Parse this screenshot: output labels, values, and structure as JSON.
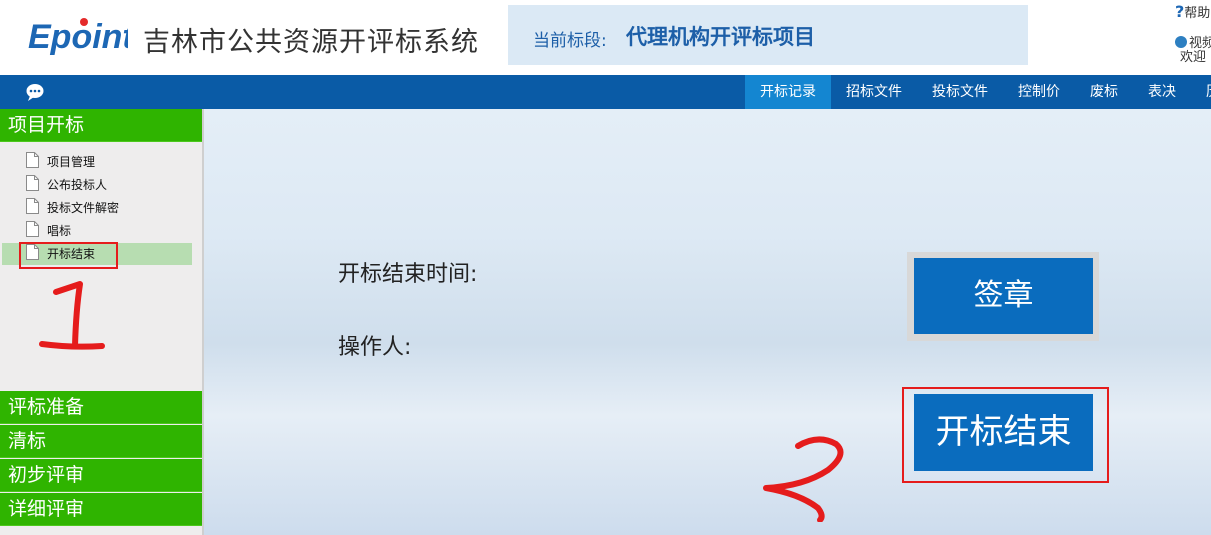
{
  "header": {
    "logo_text": "Epoint",
    "system_title": "吉林市公共资源开评标系统",
    "stage_label": "当前标段:",
    "stage_value": "代理机构开评标项目",
    "help_text": "帮助",
    "video_text": "视频",
    "welcome_text": "欢迎"
  },
  "nav": {
    "chat_icon": "chat-bubble-icon",
    "tabs": [
      {
        "label": "开标记录",
        "active": true
      },
      {
        "label": "招标文件",
        "active": false
      },
      {
        "label": "投标文件",
        "active": false
      },
      {
        "label": "控制价",
        "active": false
      },
      {
        "label": "废标",
        "active": false
      },
      {
        "label": "表决",
        "active": false
      },
      {
        "label": "历",
        "active": false
      }
    ]
  },
  "sidebar": {
    "sections": [
      {
        "label": "项目开标",
        "expanded": true
      },
      {
        "label": "评标准备"
      },
      {
        "label": "清标"
      },
      {
        "label": "初步评审"
      },
      {
        "label": "详细评审"
      }
    ],
    "items": [
      {
        "label": "项目管理"
      },
      {
        "label": "公布投标人"
      },
      {
        "label": "投标文件解密"
      },
      {
        "label": "唱标"
      },
      {
        "label": "开标结束",
        "active": true
      }
    ]
  },
  "main": {
    "end_time_label": "开标结束时间:",
    "operator_label": "操作人:",
    "sign_button": "签章",
    "end_button": "开标结束"
  },
  "colors": {
    "accent": "#0a6cbe",
    "navbar": "#0a5ba6",
    "sidebar_green": "#2fb400",
    "annotation_red": "#e51c1c"
  }
}
